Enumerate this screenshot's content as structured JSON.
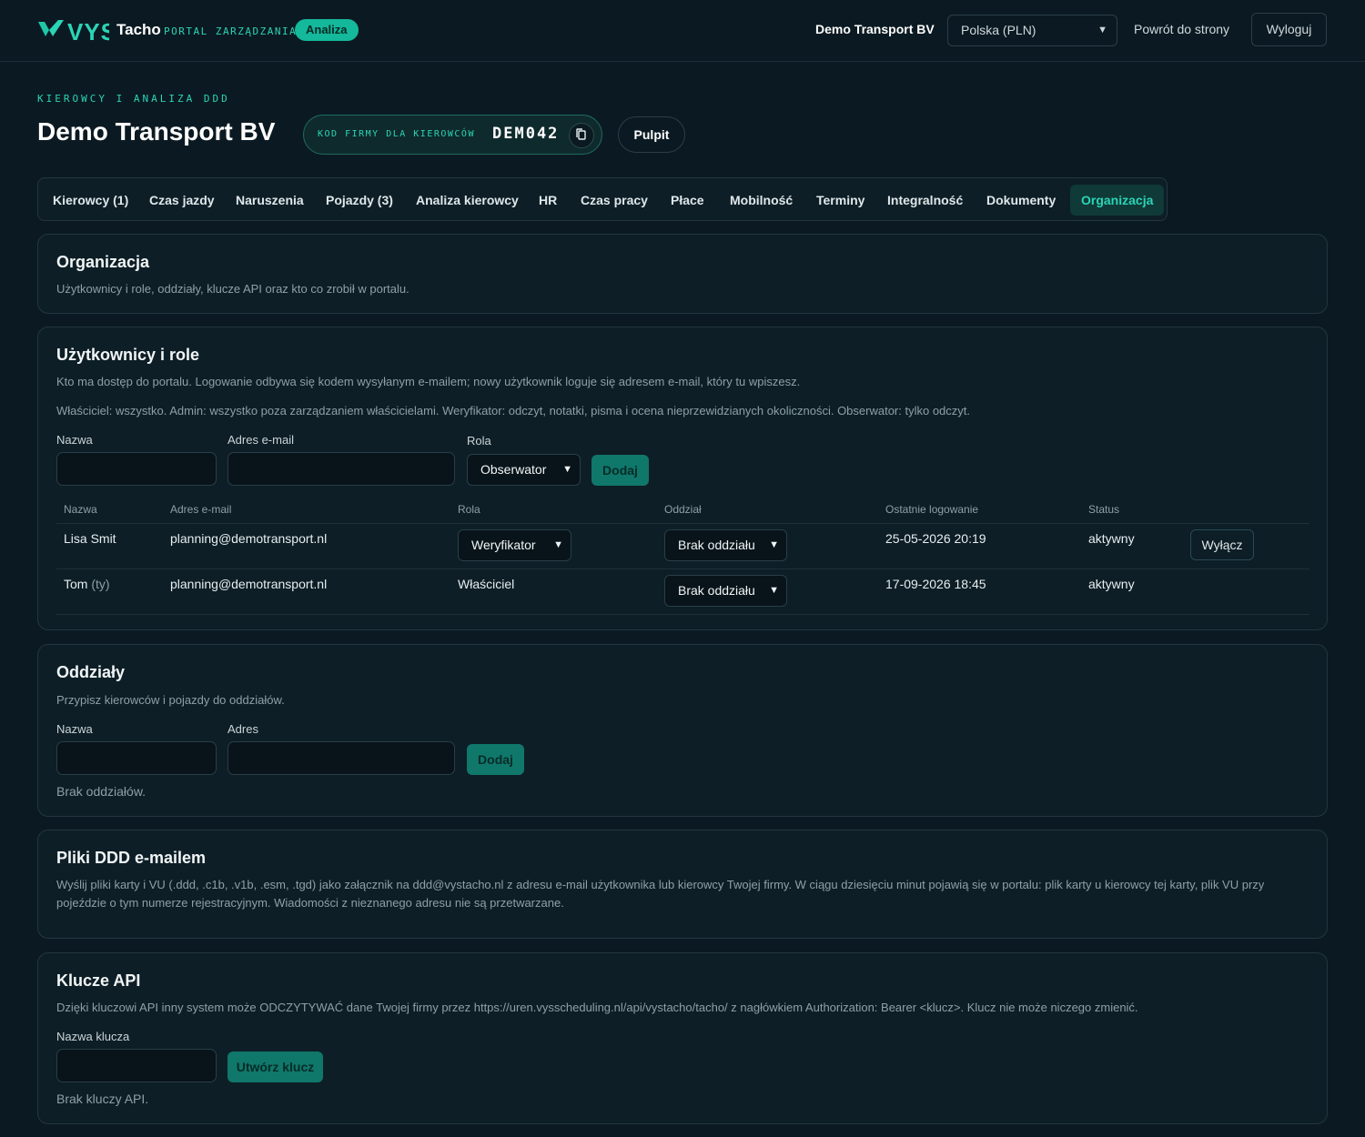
{
  "header": {
    "brand_logo": "VYS",
    "brand_name": "Tacho",
    "brand_sub": "PORTAL ZARZĄDZANIA",
    "pill": "Analiza",
    "company": "Demo Transport BV",
    "country_select": "Polska (PLN)",
    "back_link": "Powrót do strony",
    "logout": "Wyloguj"
  },
  "page": {
    "eyebrow": "KIEROWCY I ANALIZA DDD",
    "title": "Demo Transport BV",
    "code_label": "KOD FIRMY DLA KIEROWCÓW",
    "code_value": "DEM042",
    "pulpit": "Pulpit"
  },
  "tabs": [
    {
      "label": "Kierowcy (1)"
    },
    {
      "label": "Czas jazdy"
    },
    {
      "label": "Naruszenia"
    },
    {
      "label": "Pojazdy (3)"
    },
    {
      "label": "Analiza kierowcy"
    },
    {
      "label": "HR"
    },
    {
      "label": "Czas pracy"
    },
    {
      "label": "Płace"
    },
    {
      "label": "Mobilność"
    },
    {
      "label": "Terminy"
    },
    {
      "label": "Integralność"
    },
    {
      "label": "Dokumenty"
    },
    {
      "label": "Organizacja"
    }
  ],
  "org": {
    "title": "Organizacja",
    "subtitle": "Użytkownicy i role, oddziały, klucze API oraz kto co zrobił w portalu."
  },
  "users": {
    "title": "Użytkownicy i role",
    "desc1": "Kto ma dostęp do portalu. Logowanie odbywa się kodem wysyłanym e-mailem; nowy użytkownik loguje się adresem e-mail, który tu wpiszesz.",
    "desc2": "Właściciel: wszystko. Admin: wszystko poza zarządzaniem właścicielami. Weryfikator: odczyt, notatki, pisma i ocena nieprzewidzianych okoliczności. Obserwator: tylko odczyt.",
    "form": {
      "name_label": "Nazwa",
      "email_label": "Adres e-mail",
      "role_label": "Rola",
      "role_value": "Obserwator",
      "add": "Dodaj"
    },
    "columns": [
      "Nazwa",
      "Adres e-mail",
      "Rola",
      "Oddział",
      "Ostatnie logowanie",
      "Status"
    ],
    "rows": [
      {
        "name": "Lisa Smit",
        "suffix": "",
        "email": "planning@demotransport.nl",
        "role": "Weryfikator",
        "branch": "Brak oddziału",
        "last_login": "25-05-2026 20:19",
        "status": "aktywny",
        "action": "Wyłącz"
      },
      {
        "name": "Tom",
        "suffix": "(ty)",
        "email": "planning@demotransport.nl",
        "role": "Właściciel",
        "branch": "Brak oddziału",
        "last_login": "17-09-2026 18:45",
        "status": "aktywny",
        "action": ""
      }
    ]
  },
  "branches": {
    "title": "Oddziały",
    "desc": "Przypisz kierowców i pojazdy do oddziałów.",
    "name_label": "Nazwa",
    "address_label": "Adres",
    "add": "Dodaj",
    "empty": "Brak oddziałów."
  },
  "ddd_mail": {
    "title": "Pliki DDD e-mailem",
    "desc": "Wyślij pliki karty i VU (.ddd, .c1b, .v1b, .esm, .tgd) jako załącznik na ddd@vystacho.nl z adresu e-mail użytkownika lub kierowcy Twojej firmy. W ciągu dziesięciu minut pojawią się w portalu: plik karty u kierowcy tej karty, plik VU przy pojeździe o tym numerze rejestracyjnym. Wiadomości z nieznanego adresu nie są przetwarzane."
  },
  "api": {
    "title": "Klucze API",
    "desc": "Dzięki kluczowi API inny system może ODCZYTYWAĆ dane Twojej firmy przez https://uren.vysscheduling.nl/api/vystacho/tacho/ z nagłówkiem Authorization: Bearer <klucz>. Klucz nie może niczego zmienić.",
    "key_label": "Nazwa klucza",
    "create": "Utwórz klucz",
    "empty": "Brak kluczy API."
  },
  "colors": {
    "background": "#0b1a22",
    "accent": "#2bd4b6",
    "button": "#10776b"
  }
}
